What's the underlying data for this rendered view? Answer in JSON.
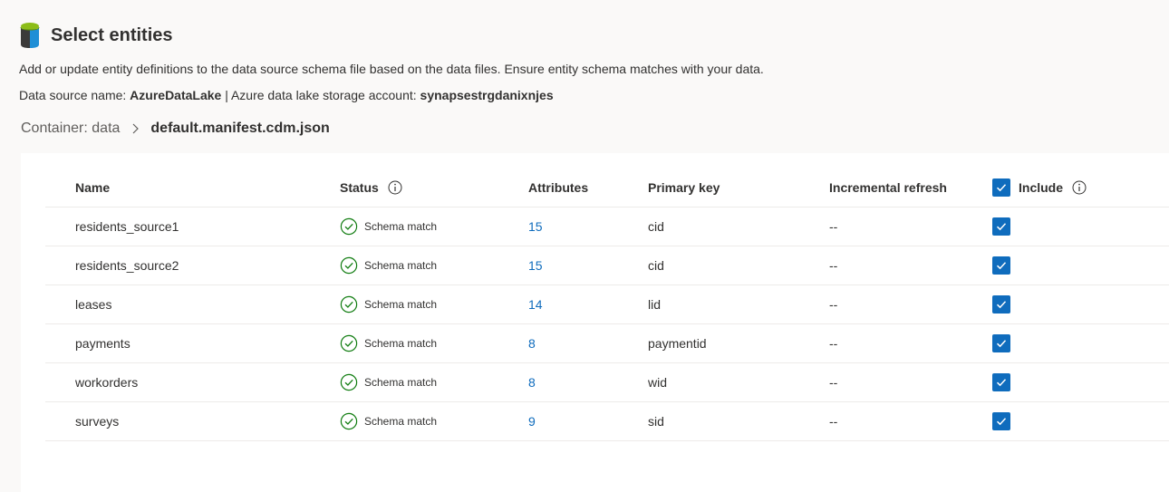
{
  "page": {
    "title": "Select entities",
    "description": "Add or update entity definitions to the data source schema file based on the data files. Ensure entity schema matches with your data.",
    "source_prefix": "Data source name: ",
    "source_name": "AzureDataLake",
    "source_separator": " | Azure data lake storage account: ",
    "storage_account": "synapsestrgdanixnjes"
  },
  "breadcrumb": {
    "container": "Container: data",
    "current": "default.manifest.cdm.json"
  },
  "table": {
    "headers": {
      "name": "Name",
      "status": "Status",
      "attributes": "Attributes",
      "primary_key": "Primary key",
      "incremental_refresh": "Incremental refresh",
      "include": "Include"
    },
    "rows": [
      {
        "name": "residents_source1",
        "status": "Schema match",
        "attributes": "15",
        "primary_key": "cid",
        "incremental": "--",
        "include": true
      },
      {
        "name": "residents_source2",
        "status": "Schema match",
        "attributes": "15",
        "primary_key": "cid",
        "incremental": "--",
        "include": true
      },
      {
        "name": "leases",
        "status": "Schema match",
        "attributes": "14",
        "primary_key": "lid",
        "incremental": "--",
        "include": true
      },
      {
        "name": "payments",
        "status": "Schema match",
        "attributes": "8",
        "primary_key": "paymentid",
        "incremental": "--",
        "include": true
      },
      {
        "name": "workorders",
        "status": "Schema match",
        "attributes": "8",
        "primary_key": "wid",
        "incremental": "--",
        "include": true
      },
      {
        "name": "surveys",
        "status": "Schema match",
        "attributes": "9",
        "primary_key": "sid",
        "incremental": "--",
        "include": true
      }
    ]
  },
  "colors": {
    "accent": "#0f6cbd",
    "success": "#107c10",
    "background": "#faf9f8"
  },
  "icons": {
    "app": "data-lake-icon",
    "info": "info-icon",
    "status": "check-circle-icon",
    "chevron": "chevron-right-icon"
  }
}
